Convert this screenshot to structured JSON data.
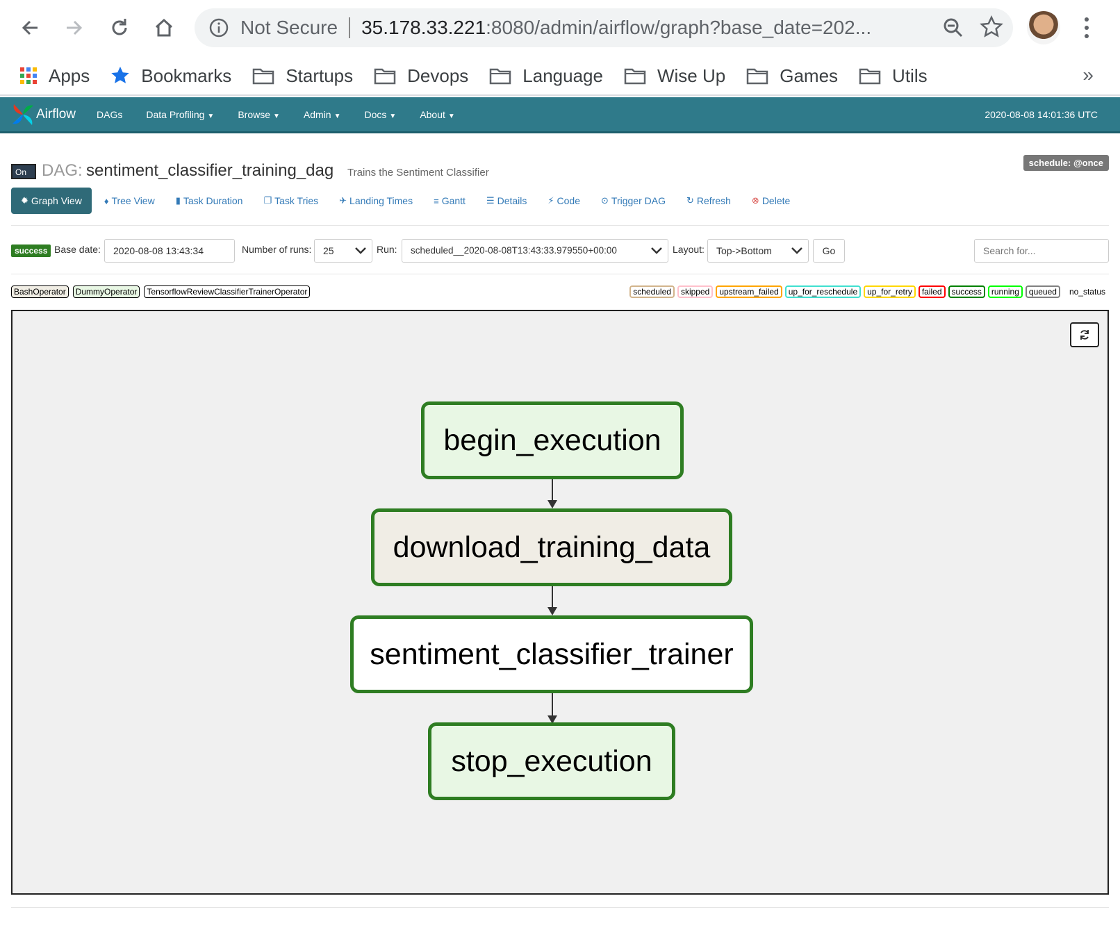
{
  "browser": {
    "security_label": "Not Secure",
    "url_host": "35.178.33.221",
    "url_rest": ":8080/admin/airflow/graph?base_date=202...",
    "bookmarks": [
      {
        "label": "Apps",
        "icon": "apps-grid-icon"
      },
      {
        "label": "Bookmarks",
        "icon": "star-icon"
      },
      {
        "label": "Startups",
        "icon": "folder-icon"
      },
      {
        "label": "Devops",
        "icon": "folder-icon"
      },
      {
        "label": "Language",
        "icon": "folder-icon"
      },
      {
        "label": "Wise Up",
        "icon": "folder-icon"
      },
      {
        "label": "Games",
        "icon": "folder-icon"
      },
      {
        "label": "Utils",
        "icon": "folder-icon"
      }
    ],
    "more_bookmarks": "»"
  },
  "navbar": {
    "brand": "Airflow",
    "menus": [
      "DAGs",
      "Data Profiling",
      "Browse",
      "Admin",
      "Docs",
      "About"
    ],
    "clock": "2020-08-08 14:01:36 UTC"
  },
  "dag": {
    "toggle": "On",
    "prefix": "DAG:",
    "id": "sentiment_classifier_training_dag",
    "description": "Trains the Sentiment Classifier",
    "schedule": "schedule: @once"
  },
  "tabs": [
    {
      "label": "Graph View",
      "icon": "✹"
    },
    {
      "label": "Tree View",
      "icon": "♦"
    },
    {
      "label": "Task Duration",
      "icon": "▮"
    },
    {
      "label": "Task Tries",
      "icon": "❐"
    },
    {
      "label": "Landing Times",
      "icon": "✈"
    },
    {
      "label": "Gantt",
      "icon": "≡"
    },
    {
      "label": "Details",
      "icon": "☰"
    },
    {
      "label": "Code",
      "icon": "⚡"
    },
    {
      "label": "Trigger DAG",
      "icon": "⊙"
    },
    {
      "label": "Refresh",
      "icon": "↻"
    },
    {
      "label": "Delete",
      "icon": "⊗"
    }
  ],
  "form": {
    "state": "success",
    "base_date_label": "Base date:",
    "base_date": "2020-08-08 13:43:34",
    "num_runs_label": "Number of runs:",
    "num_runs": "25",
    "run_label": "Run:",
    "run": "scheduled__2020-08-08T13:43:33.979550+00:00",
    "layout_label": "Layout:",
    "layout": "Top->Bottom",
    "go": "Go",
    "search_placeholder": "Search for..."
  },
  "operators": [
    "BashOperator",
    "DummyOperator",
    "TensorflowReviewClassifierTrainerOperator"
  ],
  "states": [
    {
      "label": "scheduled",
      "color": "#d2b48c"
    },
    {
      "label": "skipped",
      "color": "#ffc0cb"
    },
    {
      "label": "upstream_failed",
      "color": "#ffa500"
    },
    {
      "label": "up_for_reschedule",
      "color": "#40e0d0"
    },
    {
      "label": "up_for_retry",
      "color": "#ffd700"
    },
    {
      "label": "failed",
      "color": "#ff0000"
    },
    {
      "label": "success",
      "color": "#008000"
    },
    {
      "label": "running",
      "color": "#00ff00"
    },
    {
      "label": "queued",
      "color": "#808080"
    },
    {
      "label": "no_status",
      "color": ""
    }
  ],
  "graph": {
    "nodes": [
      {
        "label": "begin_execution",
        "fill": "#e8f7e4",
        "state": "success"
      },
      {
        "label": "download_training_data",
        "fill": "#f0ede5",
        "state": "success"
      },
      {
        "label": "sentiment_classifier_trainer",
        "fill": "#ffffff",
        "state": "success"
      },
      {
        "label": "stop_execution",
        "fill": "#e8f7e4",
        "state": "success"
      }
    ]
  }
}
